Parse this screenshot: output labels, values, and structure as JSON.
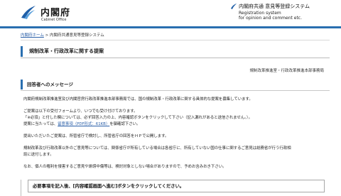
{
  "header": {
    "logo_text": "内閣府",
    "logo_sub": "Cabinet Office",
    "system_title": "内閣府共通 意見等登録システム",
    "system_sub1": "Registration system",
    "system_sub2": "for opinion and comment etc."
  },
  "breadcrumb": {
    "home": "内閣府ホーム",
    "separator": " > ",
    "current": "内閣府共通意見等登録システム"
  },
  "page_title": "規制改革・行政改革に関する提案",
  "organization": "規制改革推進室・行政改革推進本部事務局",
  "message": {
    "title": "回答者へのメッセージ",
    "lines": [
      "内閣府規制改革推進室及び内閣官房行政改革推進本部事務局では、国の規制改革・行政改革に関する具体的な提案を募集しています。",
      "ご提案は以下の受付フォームより、いつでも受け付けております。",
      "「※必須」と付した欄については、必ず回答入力の上、内容確認ボタンをクリックして下さい（記入漏れがあると送信されません。）。",
      "提案に当たっては、",
      "提出いただいたご提案は、所管省庁で検討し、所管省庁の回答をＨＰで公開します。",
      "規制改革及び行政改革以外のご意見等については、関係省庁が所有している場合は各省庁に、所有していない国の仕事に関するご意見は総務省が行う行政相",
      "談に送付します。",
      "なお、個人の権利を侵害するご意見や誹謗中傷等は、検討対象としない場合がありますので、予めお含みおき下さい。"
    ],
    "link_text": "留意事項（PDF形式：61KB）",
    "link_after": "を御確認下さい。"
  },
  "notice": "必要事項を記入後、[内容確認画面へ進む]ボタンをクリックしてください。",
  "colors": {
    "accent": "#2a6fb0",
    "link": "#2a5fa8"
  }
}
